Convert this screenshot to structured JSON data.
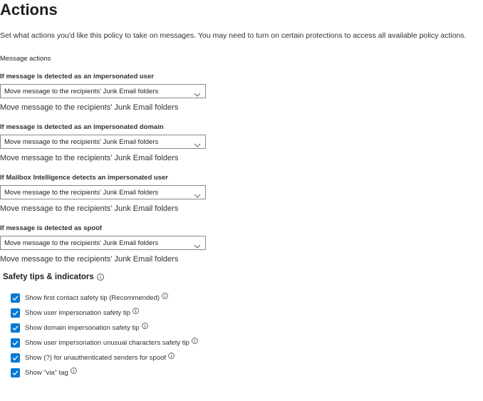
{
  "page": {
    "title": "Actions",
    "description": "Set what actions you'd like this policy to take on messages. You may need to turn on certain protections to access all available policy actions."
  },
  "message_actions": {
    "label": "Message actions",
    "items": [
      {
        "label": "If message is detected as an impersonated user",
        "selected": "Move message to the recipients' Junk Email folders",
        "echo": "Move message to the recipients' Junk Email folders"
      },
      {
        "label": "If message is detected as an impersonated domain",
        "selected": "Move message to the recipients' Junk Email folders",
        "echo": "Move message to the recipients' Junk Email folders"
      },
      {
        "label": "If Mailbox Intelligence detects an impersonated user",
        "selected": "Move message to the recipients' Junk Email folders",
        "echo": "Move message to the recipients' Junk Email folders"
      },
      {
        "label": "If message is detected as spoof",
        "selected": "Move message to the recipients' Junk Email folders",
        "echo": "Move message to the recipients' Junk Email folders"
      }
    ]
  },
  "safety_tips": {
    "heading": "Safety tips & indicators",
    "items": [
      {
        "label": "Show first contact safety tip (Recommended)",
        "checked": true
      },
      {
        "label": "Show user impersonation safety tip",
        "checked": true
      },
      {
        "label": "Show domain impersonation safety tip",
        "checked": true
      },
      {
        "label": "Show user impersonation unusual characters safety tip",
        "checked": true
      },
      {
        "label": "Show (?) for unauthenticated senders for spoof",
        "checked": true
      },
      {
        "label": "Show “via” tag",
        "checked": true
      }
    ]
  },
  "icons": {
    "dropdown": "chevron-down-icon",
    "info": "info-icon",
    "check": "checkmark-icon"
  },
  "colors": {
    "checkbox_fill": "#0078d4",
    "text_primary": "#201f1e",
    "border": "#8a8886"
  }
}
